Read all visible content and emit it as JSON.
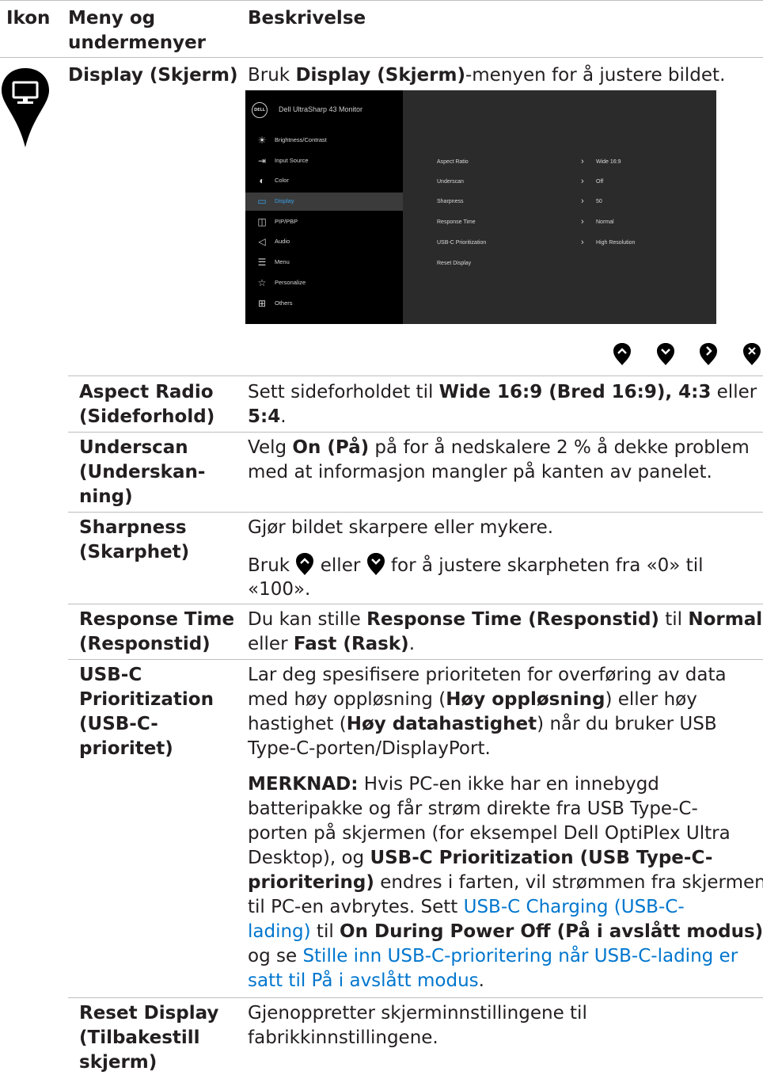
{
  "header": {
    "col_icon": "Ikon",
    "col_menu_line1": "Meny og",
    "col_menu_line2": "undermenyer",
    "col_desc": "Beskrivelse"
  },
  "display_row": {
    "icon": "monitor-icon",
    "name": "Display (Skjerm)",
    "desc_pre": "Bruk ",
    "desc_bold": "Display (Skjerm)",
    "desc_post": "-menyen for å justere bildet."
  },
  "osd": {
    "logo": "DELL",
    "title": "Dell UltraSharp 43 Monitor",
    "menu": [
      {
        "label": "Brightness/Contrast",
        "icon": "brightness-icon",
        "selected": false
      },
      {
        "label": "Input Source",
        "icon": "input-source-icon",
        "selected": false
      },
      {
        "label": "Color",
        "icon": "color-icon",
        "selected": false
      },
      {
        "label": "Display",
        "icon": "display-icon",
        "selected": true
      },
      {
        "label": "PIP/PBP",
        "icon": "pip-pbp-icon",
        "selected": false
      },
      {
        "label": "Audio",
        "icon": "audio-icon",
        "selected": false
      },
      {
        "label": "Menu",
        "icon": "menu-icon",
        "selected": false
      },
      {
        "label": "Personalize",
        "icon": "star-icon",
        "selected": false
      },
      {
        "label": "Others",
        "icon": "others-icon",
        "selected": false
      }
    ],
    "settings": [
      {
        "label": "Aspect Ratio",
        "value": "Wide 16:9"
      },
      {
        "label": "Underscan",
        "value": "Off"
      },
      {
        "label": "Sharpness",
        "value": "50"
      },
      {
        "label": "Response Time",
        "value": "Normal"
      },
      {
        "label": "USB-C Prioritization",
        "value": "High Resolution"
      },
      {
        "label": "Reset Display",
        "value": ""
      }
    ],
    "buttons": [
      "up-icon",
      "down-icon",
      "right-icon",
      "close-icon"
    ]
  },
  "rows": {
    "aspect": {
      "name1": "Aspect Radio",
      "name2": "(Sideforhold)",
      "l1_pre": "Sett sideforholdet til ",
      "l1_bold": "Wide 16:9 (Bred 16:9), 4:3",
      "l1_post": " eller",
      "l2_bold": "5:4",
      "l2_post": "."
    },
    "underscan": {
      "name1": "Underscan",
      "name2": "(Underskan-",
      "name3": "ning)",
      "l1_pre": "Velg ",
      "l1_bold": "On (På)",
      "l1_post": " på for å nedskalere 2 % å dekke problem",
      "l2": "med at informasjon mangler på kanten av panelet."
    },
    "sharpness": {
      "name1": "Sharpness",
      "name2": "(Skarphet)",
      "p1": "Gjør bildet skarpere eller mykere.",
      "p2_pre": "Bruk ",
      "p2_mid": " eller ",
      "p2_post": " for å justere skarpheten fra «0» til",
      "p2_l2": "«100»."
    },
    "response": {
      "name1": "Response Time",
      "name2": "(Responstid)",
      "l1_pre": "Du kan stille ",
      "l1_bold": "Response Time (Responstid)",
      "l1_mid": " til ",
      "l1_bold2": "Normal",
      "l2_pre": "eller ",
      "l2_bold": "Fast (Rask)",
      "l2_post": "."
    },
    "usbc": {
      "name1": "USB-C",
      "name2": "Prioritization",
      "name3": "(USB-C-",
      "name4": "prioritet)",
      "p1_l1": "Lar deg spesifisere prioriteten for overføring av data",
      "p1_l2_pre": "med høy oppløsning (",
      "p1_l2_bold": "Høy oppløsning",
      "p1_l2_post": ") eller høy",
      "p1_l3_pre": "hastighet (",
      "p1_l3_bold": "Høy datahastighet",
      "p1_l3_post": ") når du bruker USB",
      "p1_l4": "Type-C-porten/DisplayPort.",
      "note_l1_bold": "MERKNAD:",
      "note_l1": " Hvis PC-en ikke har en innebygd",
      "note_l2": "batteripakke og får strøm direkte fra USB Type-C-",
      "note_l3": "porten på skjermen (for eksempel Dell OptiPlex Ultra",
      "note_l4_pre": "Desktop), og ",
      "note_l4_bold": "USB-C Prioritization (USB Type-C-",
      "note_l5_bold": "prioritering)",
      "note_l5_post": " endres i farten, vil strømmen fra skjermen",
      "note_l6_pre": "til PC-en avbrytes. Sett ",
      "note_l6_link": "USB-C Charging (USB-C-",
      "note_l7_link": "lading)",
      "note_l7_mid": " til ",
      "note_l7_bold": "On During Power Off (På i avslått modus)",
      "note_l8_pre": "og se ",
      "note_l8_link": "Stille inn USB-C-prioritering når USB-C-lading er",
      "note_l9_link": "satt til På i avslått modus",
      "note_l9_post": "."
    },
    "reset": {
      "name1": "Reset Display",
      "name2": "(Tilbakestill",
      "name3": "skjerm)",
      "l1": "Gjenoppretter skjerminnstillingene til",
      "l2": "fabrikkinnstillingene."
    }
  }
}
